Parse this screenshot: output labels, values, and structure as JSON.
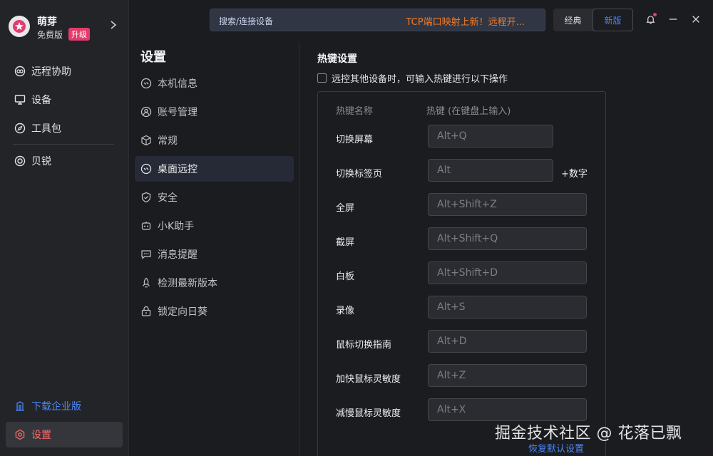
{
  "profile": {
    "name": "萌芽",
    "plan": "免费版",
    "upgrade": "升级"
  },
  "sidebar": {
    "items": [
      {
        "label": "远程协助",
        "icon": "remote-assist-icon"
      },
      {
        "label": "设备",
        "icon": "monitor-icon"
      },
      {
        "label": "工具包",
        "icon": "compass-icon"
      },
      {
        "label": "贝锐",
        "icon": "oray-icon"
      }
    ],
    "download": "下载企业版",
    "settings": "设置"
  },
  "topbar": {
    "search_label": "搜索/连接设备",
    "promo": "TCP端口映射上新！远程开...",
    "mode_classic": "经典",
    "mode_new": "新版"
  },
  "settings_nav": {
    "title": "设置",
    "items": [
      {
        "label": "本机信息",
        "icon": "link-icon"
      },
      {
        "label": "账号管理",
        "icon": "user-icon"
      },
      {
        "label": "常规",
        "icon": "box-icon"
      },
      {
        "label": "桌面远控",
        "icon": "link-icon"
      },
      {
        "label": "安全",
        "icon": "shield-icon"
      },
      {
        "label": "小K助手",
        "icon": "robot-icon"
      },
      {
        "label": "消息提醒",
        "icon": "message-icon"
      },
      {
        "label": "检测最新版本",
        "icon": "rocket-icon"
      },
      {
        "label": "锁定向日葵",
        "icon": "lock-icon"
      }
    ],
    "active_index": 3
  },
  "main": {
    "section_title": "热键设置",
    "checkbox_label": "远控其他设备时，可输入热键进行以下操作",
    "col_name": "热键名称",
    "col_key": "热键 (在键盘上输入)",
    "hotkeys": [
      {
        "name": "切换屏幕",
        "key": "Alt+Q"
      },
      {
        "name": "切换标签页",
        "key": "Alt",
        "suffix": "+数字"
      },
      {
        "name": "全屏",
        "key": "Alt+Shift+Z"
      },
      {
        "name": "截屏",
        "key": "Alt+Shift+Q"
      },
      {
        "name": "白板",
        "key": "Alt+Shift+D"
      },
      {
        "name": "录像",
        "key": "Alt+S"
      },
      {
        "name": "鼠标切换指南",
        "key": "Alt+D"
      },
      {
        "name": "加快鼠标灵敏度",
        "key": "Alt+Z"
      },
      {
        "name": "减慢鼠标灵敏度",
        "key": "Alt+X"
      }
    ],
    "reset": "恢复默认设置"
  },
  "watermark": "掘金技术社区 @ 花落已飘",
  "colors": {
    "accent": "#4a86f7",
    "promo": "#f07a2a",
    "badge": "#e23c6c",
    "active_settings": "#ff6a6a"
  }
}
